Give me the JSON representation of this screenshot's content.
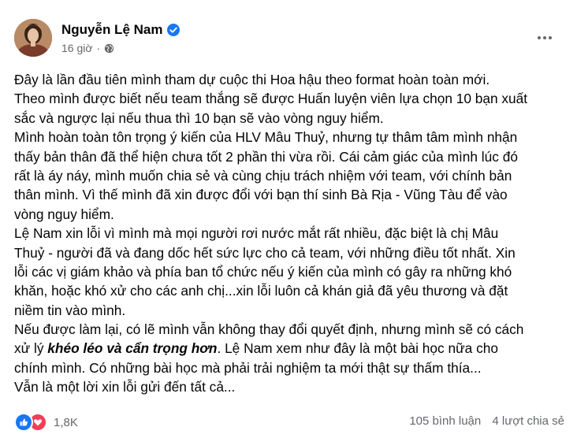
{
  "post": {
    "author": "Nguyễn Lệ Nam",
    "time": "16 giờ",
    "separator": "·",
    "body_lines": [
      "Đây là lần đầu tiên mình tham dự cuộc thi Hoa hậu theo format hoàn toàn mới.",
      "Theo mình được biết nếu team thắng sẽ được Huấn luyện viên lựa chọn 10 bạn xuất",
      "sắc và ngược lại nếu thua thì 10 bạn sẽ vào vòng nguy hiểm.",
      "Mình hoàn toàn tôn trọng ý kiến của HLV Mâu Thuỷ, nhưng tự thâm tâm mình nhận",
      "thấy bản thân đã thể hiện chưa tốt 2 phần thi vừa rồi. Cái cảm giác của mình lúc đó",
      "rất là áy náy, mình muốn chia sẻ và cùng chịu trách nhiệm với team, với chính bản",
      "thân mình. Vì thế mình đã xin được đổi với bạn thí sinh Bà Rịa - Vũng Tàu để vào",
      "vòng nguy hiểm.",
      "Lệ Nam xin lỗi vì mình mà mọi người rơi nước mắt rất nhiều, đặc biệt là chị Mâu",
      "Thuỷ - người đã và đang dốc hết sức lực cho cả team, với những điều tốt nhất. Xin",
      "lỗi các vị giám khảo và phía ban tổ chức nếu ý kiến của mình có gây ra những khó",
      "khăn, hoặc khó xử cho các anh chị...xin lỗi luôn cả khán giả đã yêu thương và đặt",
      "niềm tin vào mình.",
      "Nếu được làm lại, có lẽ mình vẫn không thay đổi quyết định, nhưng mình sẽ có cách"
    ],
    "line_15": {
      "before": "xử lý ",
      "emphasis": "khéo léo và cẩn trọng hơn",
      "after": ". Lệ Nam xem như đây là một bài học nữa cho"
    },
    "body_lines_end": [
      "chính mình. Có những bài học mà phải trải nghiệm ta mới thật sự thấm thía...",
      "Vẫn là một lời xin lỗi gửi đến tất cả..."
    ],
    "reaction_count": "1,8K",
    "comments": "105 bình luận",
    "shares": "4 lượt chia sẻ"
  },
  "colors": {
    "text": "#050505",
    "secondary": "#65676b",
    "like": "#1877f2",
    "love": "#f33e58",
    "verified": "#1877f2"
  }
}
